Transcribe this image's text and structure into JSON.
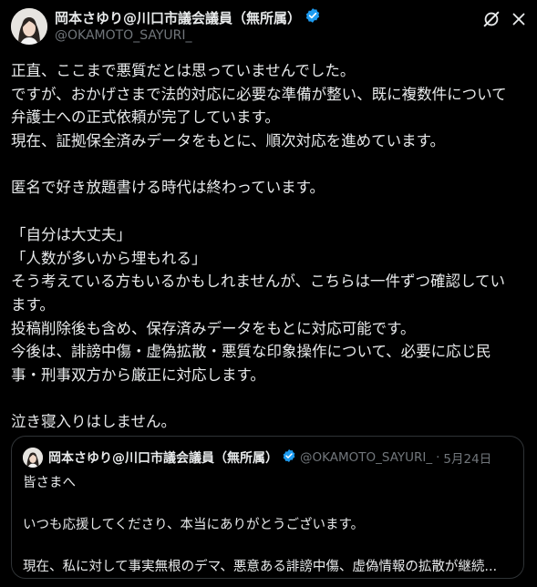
{
  "post": {
    "author_name": "岡本さゆり@川口市議会議員（無所属）",
    "handle": "@OKAMOTO_SAYURI_",
    "body_lines": [
      "正直、ここまで悪質だとは思っていませんでした。",
      "ですが、おかげさまで法的対応に必要な準備が整い、既に複数件について",
      "弁護士への正式依頼が完了しています。",
      "現在、証拠保全済みデータをもとに、順次対応を進めています。",
      "",
      "匿名で好き放題書ける時代は終わっています。",
      "",
      "「自分は大丈夫」",
      "「人数が多いから埋もれる」",
      "そう考えている方もいるかもしれませんが、こちらは一件ずつ確認してい",
      "ます。",
      "投稿削除後も含め、保存済みデータをもとに対応可能です。",
      "今後は、誹謗中傷・虚偽拡散・悪質な印象操作について、必要に応じ民",
      "事・刑事双方から厳正に対応します。",
      "",
      "泣き寝入りはしません。"
    ]
  },
  "quote": {
    "author_name": "岡本さゆり@川口市議会議員（無所属）",
    "handle": "@OKAMOTO_SAYURI_",
    "separator": "·",
    "date": "5月24日",
    "lines": [
      "皆さまへ",
      "",
      "いつも応援してくださり、本当にありがとうございます。",
      "",
      "現在、私に対して事実無根のデマ、悪意ある誹謗中傷、虚偽情報の拡散が継続..."
    ]
  },
  "icons": {
    "verified": "verified-badge-icon",
    "grok": "grok-icon",
    "more": "more-options-icon"
  },
  "colors": {
    "background": "#000000",
    "text": "#e7e9ea",
    "secondary": "#71767b",
    "verified": "#1d9bf0",
    "border": "#2f3336"
  }
}
